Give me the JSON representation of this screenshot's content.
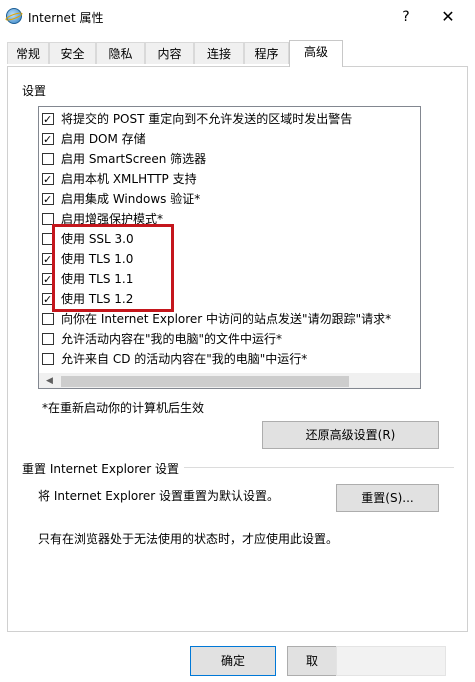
{
  "window": {
    "title": "Internet 属性",
    "help": "?",
    "close": "✕"
  },
  "tabs": [
    "常规",
    "安全",
    "隐私",
    "内容",
    "连接",
    "程序",
    "高级"
  ],
  "active_tab": "高级",
  "settings_label": "设置",
  "options": [
    {
      "label": "将提交的 POST 重定向到不允许发送的区域时发出警告",
      "checked": true
    },
    {
      "label": "启用 DOM 存储",
      "checked": true
    },
    {
      "label": "启用 SmartScreen 筛选器",
      "checked": false
    },
    {
      "label": "启用本机 XMLHTTP 支持",
      "checked": true
    },
    {
      "label": "启用集成 Windows 验证*",
      "checked": true
    },
    {
      "label": "启用增强保护模式*",
      "checked": false
    },
    {
      "label": "使用 SSL 3.0",
      "checked": false
    },
    {
      "label": "使用 TLS 1.0",
      "checked": true
    },
    {
      "label": "使用 TLS 1.1",
      "checked": true
    },
    {
      "label": "使用 TLS 1.2",
      "checked": true
    },
    {
      "label": "向你在 Internet Explorer 中访问的站点发送\"请勿跟踪\"请求*",
      "checked": false
    },
    {
      "label": "允许活动内容在\"我的电脑\"的文件中运行*",
      "checked": false
    },
    {
      "label": "允许来自 CD 的活动内容在\"我的电脑\"中运行*",
      "checked": false
    }
  ],
  "restart_note": "*在重新启动你的计算机后生效",
  "restore_button": "还原高级设置(R)",
  "reset_section": {
    "title": "重置 Internet Explorer 设置",
    "description": "将 Internet Explorer 设置重置为默认设置。",
    "button": "重置(S)...",
    "hint": "只有在浏览器处于无法使用的状态时，才应使用此设置。"
  },
  "footer": {
    "ok": "确定",
    "cancel": "取",
    "apply": ""
  },
  "highlight_color": "#c4161c"
}
